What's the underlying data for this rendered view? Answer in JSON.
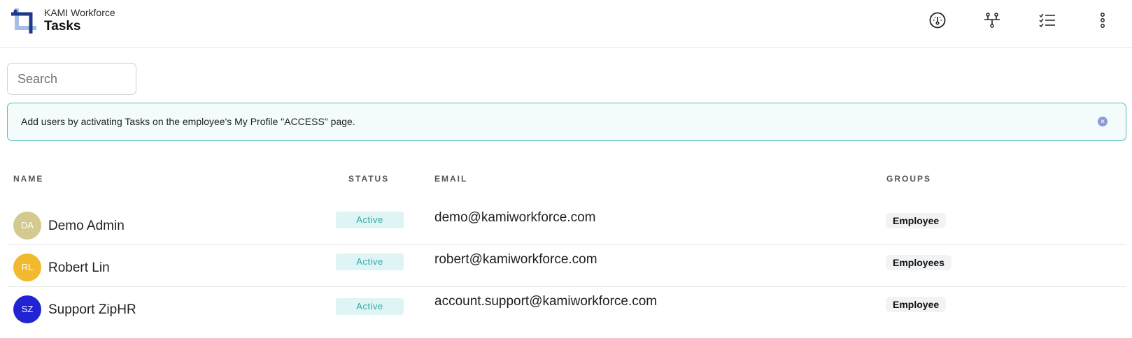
{
  "header": {
    "app_name": "KAMI Workforce",
    "page_title": "Tasks",
    "icons": [
      "dashboard-gauge-icon",
      "org-chart-icon",
      "checklist-icon",
      "more-vertical-icon"
    ]
  },
  "search": {
    "placeholder": "Search"
  },
  "banner": {
    "text": "Add users by activating Tasks on the employee's My Profile \"ACCESS\" page.",
    "close_icon": "close-icon"
  },
  "table": {
    "columns": {
      "name": "NAME",
      "status": "STATUS",
      "email": "EMAIL",
      "groups": "GROUPS"
    },
    "rows": [
      {
        "initials": "DA",
        "avatar_color": "#d4c98f",
        "name": "Demo Admin",
        "status": "Active",
        "email": "demo@kamiworkforce.com",
        "group": "Employee"
      },
      {
        "initials": "RL",
        "avatar_color": "#f0b92e",
        "name": "Robert Lin",
        "status": "Active",
        "email": "robert@kamiworkforce.com",
        "group": "Employees"
      },
      {
        "initials": "SZ",
        "avatar_color": "#2323d6",
        "name": "Support ZipHR",
        "status": "Active",
        "email": "account.support@kamiworkforce.com",
        "group": "Employee"
      }
    ]
  },
  "colors": {
    "accent_teal": "#4fc0b8",
    "status_bg": "#dff4f4",
    "status_text": "#2aa8a8"
  }
}
